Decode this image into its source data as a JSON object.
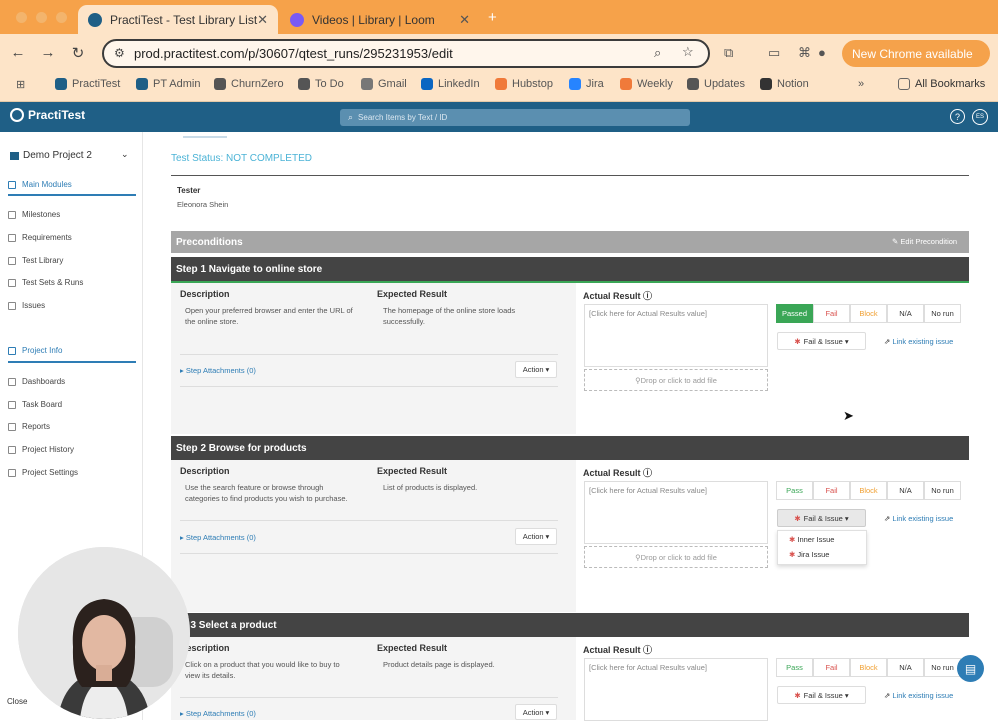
{
  "browser": {
    "tabs": [
      {
        "title": "PractiTest - Test Library List",
        "active": true
      },
      {
        "title": "Videos | Library | Loom",
        "active": false
      }
    ],
    "new_tab_label": "+",
    "url": "prod.practitest.com/p/30607/qtest_runs/295231953/edit",
    "new_chrome_label": "New Chrome available",
    "bookmarks": [
      "PractiTest",
      "PT Admin",
      "ChurnZero",
      "To Do",
      "Gmail",
      "LinkedIn",
      "Hubstop",
      "Jira",
      "Weekly",
      "Updates",
      "Notion"
    ],
    "more_bookmarks": "»",
    "all_bookmarks": "All Bookmarks"
  },
  "app": {
    "logo": "PractiTest",
    "search_placeholder": "Search Items by Text / ID",
    "help": "?",
    "user_initials": "ES"
  },
  "sidebar": {
    "project": "Demo Project 2",
    "main_modules_title": "Main Modules",
    "main_items": [
      "Milestones",
      "Requirements",
      "Test Library",
      "Test Sets & Runs",
      "Issues"
    ],
    "project_info_title": "Project Info",
    "info_items": [
      "Dashboards",
      "Task Board",
      "Reports",
      "Project History",
      "Project Settings"
    ]
  },
  "test": {
    "status": "Test Status: NOT COMPLETED",
    "tester_label": "Tester",
    "tester_name": "Eleonora Shein",
    "preconditions_label": "Preconditions",
    "edit_precondition": "Edit Precondition"
  },
  "labels": {
    "description": "Description",
    "expected": "Expected Result",
    "actual": "Actual Result",
    "attachments": "Step Attachments (0)",
    "action": "Action",
    "actual_placeholder": "[Click here for Actual Results value]",
    "drop": "Drop or click to add file",
    "pass": "Pass",
    "passed": "Passed",
    "fail": "Fail",
    "block": "Block",
    "na": "N/A",
    "no_run": "No run",
    "fail_issue": "Fail & Issue",
    "link_existing": "Link existing issue"
  },
  "steps": [
    {
      "title": "Step 1 Navigate to online store",
      "description": "Open your preferred browser and enter the URL of the online store.",
      "expected": "The homepage of the online store loads successfully."
    },
    {
      "title": "Step 2 Browse for products",
      "description": "Use the search feature or browse through categories to find products you wish to purchase.",
      "expected": "List of products is displayed."
    },
    {
      "title": "ep 3 Select a product",
      "description": "Click on a product that you would like to buy to view its details.",
      "expected": "Product details page is displayed."
    }
  ],
  "dropdown": {
    "items": [
      "Inner Issue",
      "Jira Issue"
    ]
  },
  "overlay": {
    "close": "Close"
  },
  "colors": {
    "header": "#1f5f86",
    "passed": "#3aa656",
    "fail": "#d9534f",
    "block": "#f0a033",
    "link": "#2e7db5"
  }
}
